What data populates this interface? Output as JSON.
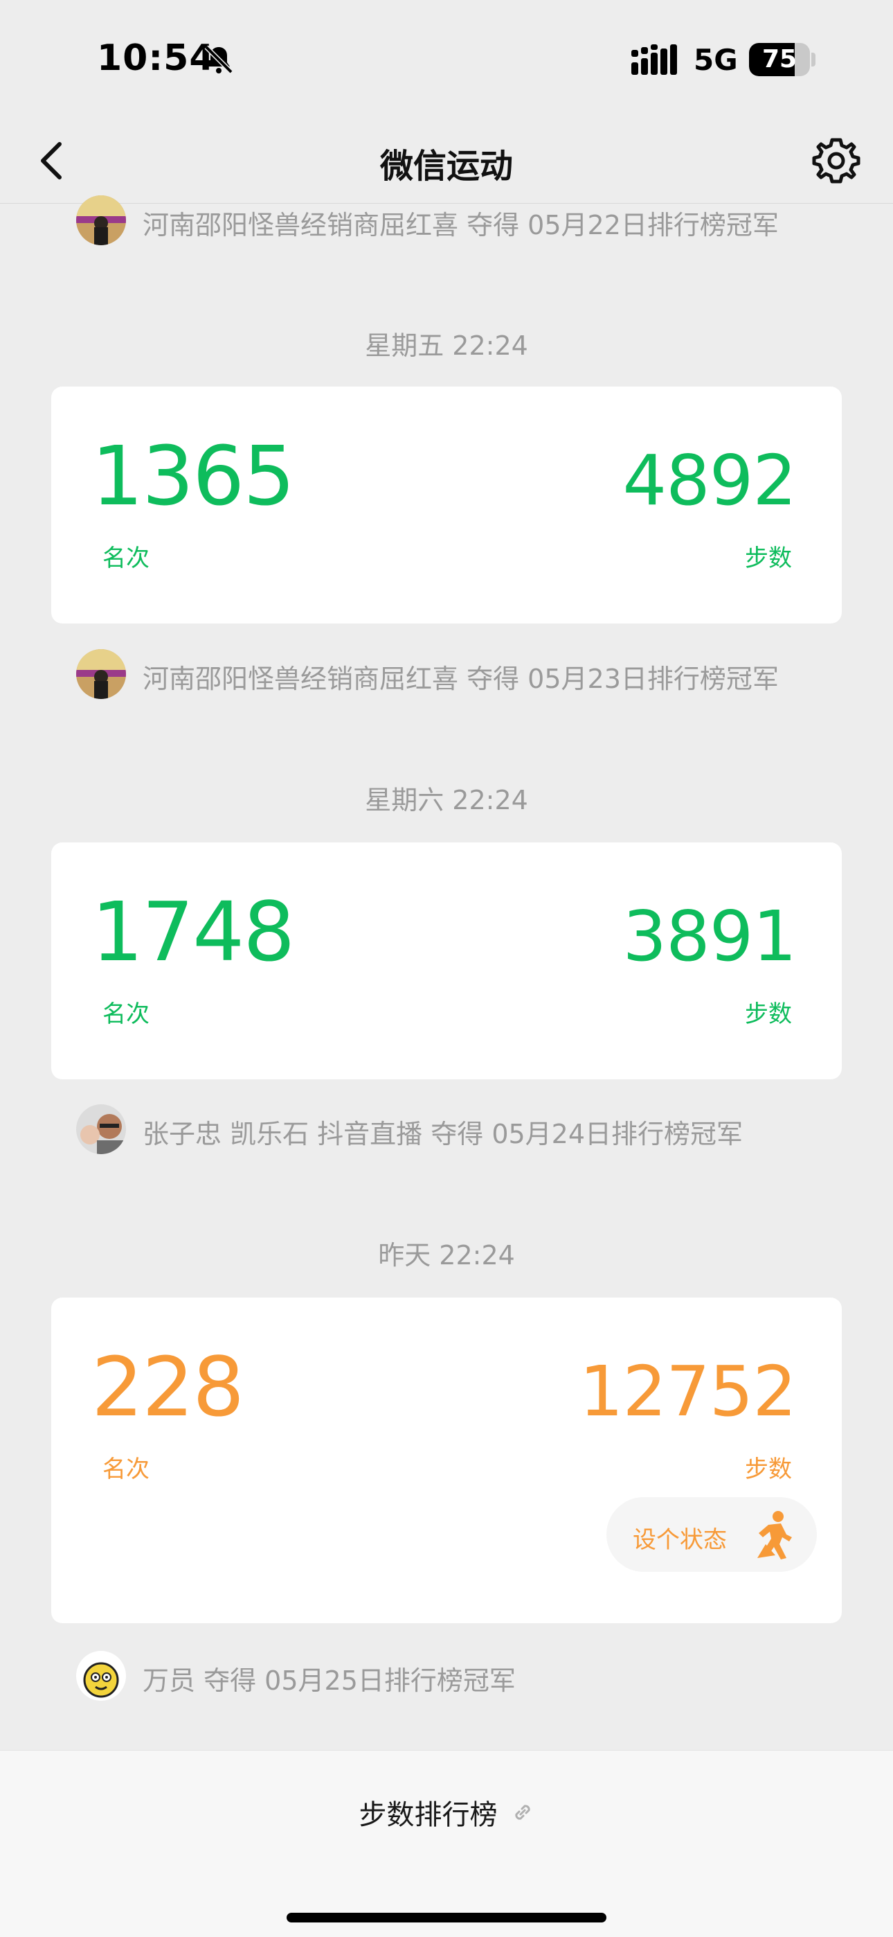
{
  "status_bar": {
    "time": "10:54",
    "network": "5G",
    "battery": "75",
    "battery_level": 0.75,
    "icons": [
      "bell-slash-icon",
      "signal-icon",
      "battery-icon"
    ]
  },
  "nav": {
    "title": "微信运动",
    "icons": [
      "chevron-left-icon",
      "gear-icon"
    ]
  },
  "feed": {
    "champions": [
      {
        "text": "河南邵阳怪兽经销商屈红喜 夺得 05月22日排行榜冠军"
      },
      {
        "text": "河南邵阳怪兽经销商屈红喜 夺得 05月23日排行榜冠军"
      },
      {
        "text": "张子忠 凯乐石 抖音直播 夺得 05月24日排行榜冠军"
      },
      {
        "text": "万员 夺得 05月25日排行榜冠军"
      }
    ],
    "days": [
      {
        "time": "星期五 22:24",
        "rank": "1365",
        "rank_label": "名次",
        "steps": "4892",
        "steps_label": "步数",
        "color": "#0ebc5c"
      },
      {
        "time": "星期六 22:24",
        "rank": "1748",
        "rank_label": "名次",
        "steps": "3891",
        "steps_label": "步数",
        "color": "#0ebc5c"
      },
      {
        "time": "昨天 22:24",
        "rank": "228",
        "rank_label": "名次",
        "steps": "12752",
        "steps_label": "步数",
        "color": "#f79a38",
        "status_button": "设个状态",
        "status_icon": "runner-icon"
      }
    ]
  },
  "bottom": {
    "leaderboard_label": "步数排行榜",
    "icon": "link-icon"
  }
}
